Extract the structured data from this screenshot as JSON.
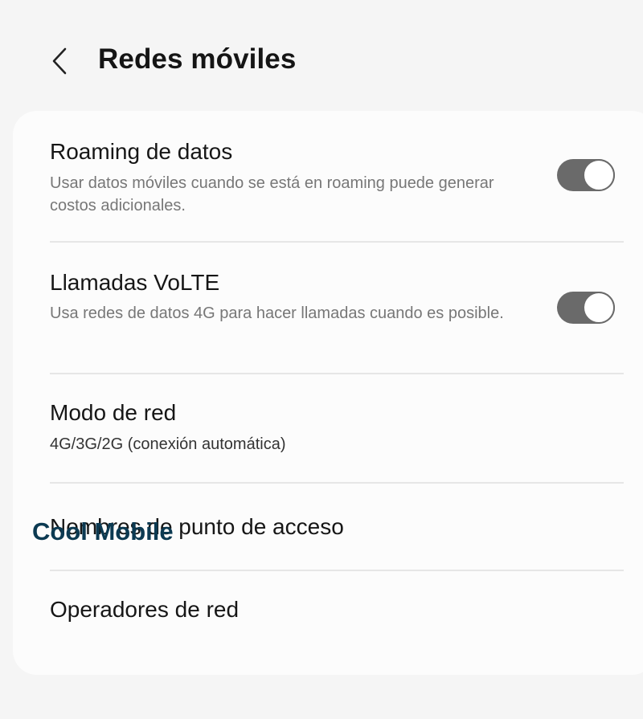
{
  "header": {
    "title": "Redes móviles",
    "back_icon": "chevron-left-icon"
  },
  "settings": {
    "roaming": {
      "title": "Roaming de datos",
      "subtitle": "Usar datos móviles cuando se está en roaming puede generar costos adicionales.",
      "enabled": true
    },
    "volte": {
      "title": "Llamadas VoLTE",
      "subtitle": "Usa redes de datos 4G para hacer llamadas cuando es posible.",
      "enabled": true
    },
    "network_mode": {
      "title": "Modo de red",
      "value": "4G/3G/2G (conexión automática)"
    },
    "apn": {
      "title": "Nombres de punto de acceso"
    },
    "operators": {
      "title": "Operadores de red"
    }
  },
  "brand": {
    "label": "Cool Mobile",
    "color": "#0c3a52"
  },
  "colors": {
    "background": "#f5f5f5",
    "card": "#fcfcfc",
    "toggle_on": "#6a6a6a"
  }
}
